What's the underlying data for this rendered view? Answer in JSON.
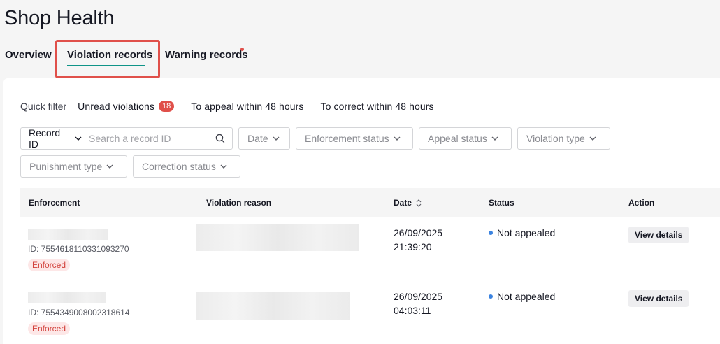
{
  "page": {
    "title": "Shop Health"
  },
  "tabs": [
    {
      "label": "Overview"
    },
    {
      "label": "Violation records"
    },
    {
      "label": "Warning records"
    }
  ],
  "quick_filter": {
    "label": "Quick filter",
    "items": [
      {
        "label": "Unread violations",
        "badge": "18"
      },
      {
        "label": "To appeal within 48 hours"
      },
      {
        "label": "To correct within 48 hours"
      }
    ]
  },
  "filters": {
    "record_id_select": "Record ID",
    "search_placeholder": "Search a record ID",
    "date": "Date",
    "enforcement_status": "Enforcement status",
    "appeal_status": "Appeal status",
    "violation_type": "Violation type",
    "punishment_type": "Punishment type",
    "correction_status": "Correction status"
  },
  "table": {
    "columns": [
      "Enforcement",
      "Violation reason",
      "Date",
      "Status",
      "Action"
    ],
    "rows": [
      {
        "id": "ID: 7554618110331093270",
        "tag": "Enforced",
        "date": "26/09/2025",
        "time": "21:39:20",
        "status": "Not appealed",
        "action": "View details"
      },
      {
        "id": "ID: 7554349008002318614",
        "tag": "Enforced",
        "date": "26/09/2025",
        "time": "04:03:11",
        "status": "Not appealed",
        "action": "View details"
      }
    ]
  },
  "colors": {
    "accent": "#0f9488",
    "badge": "#e0504a",
    "status_dot": "#3b83e0"
  }
}
